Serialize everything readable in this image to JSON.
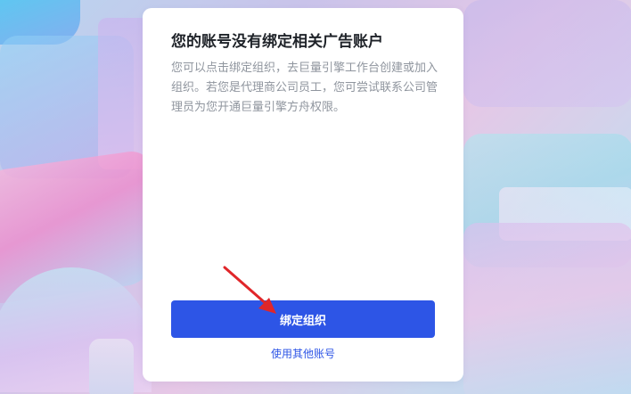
{
  "dialog": {
    "title": "您的账号没有绑定相关广告账户",
    "description": "您可以点击绑定组织，去巨量引擎工作台创建或加入组织。若您是代理商公司员工，您可尝试联系公司管理员为您开通巨量引擎方舟权限。",
    "primary_button_label": "绑定组织",
    "secondary_link_label": "使用其他账号"
  },
  "colors": {
    "accent": "#2d55e6",
    "arrow": "#e0262a",
    "title": "#1f2329",
    "description": "#8f959e"
  },
  "annotations": {
    "arrow_icon": "red-arrow-pointing-to-button"
  }
}
